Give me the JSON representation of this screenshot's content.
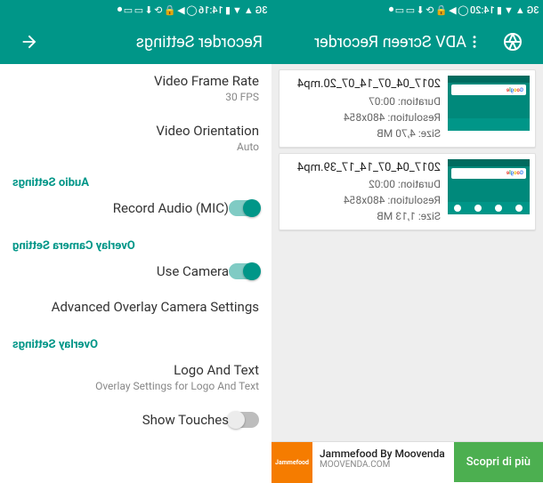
{
  "status_time_left": "14:16",
  "status_time_right": "14:20",
  "status_net": "3G",
  "left": {
    "title": "Recorder Settings",
    "video_frame_rate": {
      "label": "Video Frame Rate",
      "value": "30 FPS"
    },
    "video_orientation": {
      "label": "Video Orientation",
      "value": "Auto"
    },
    "audio_section": "Audio Settings",
    "record_audio": {
      "label": "Record Audio (MIC)",
      "on": true
    },
    "camera_section": "Overlay Camera Setting",
    "use_camera": {
      "label": "Use Camera",
      "on": true
    },
    "adv_camera": {
      "label": "Advanced Overlay Camera Settings"
    },
    "overlay_section": "Overlay Settings",
    "logo_text": {
      "label": "Logo And Text",
      "sub": "Overlay Settings for Logo And Text"
    },
    "show_touches": {
      "label": "Show Touches",
      "on": false
    }
  },
  "right": {
    "title": "ADV Screen Recorder",
    "items": [
      {
        "name": "2017_04_07_14_07_20.mp4",
        "duration": "Duration: 00:07",
        "resolution": "Resolution: 480x854",
        "size": "Size: 4,70 MB"
      },
      {
        "name": "2017_04_07_14_17_39.mp4",
        "duration": "Duration: 00:02",
        "resolution": "Resolution: 480x854",
        "size": "Size: 1,13 MB"
      }
    ],
    "ad": {
      "title": "Jammefood By Moovenda",
      "subtitle": "MOOVENDA.COM",
      "cta": "Scopri di più",
      "logo": "Jammefood"
    }
  }
}
